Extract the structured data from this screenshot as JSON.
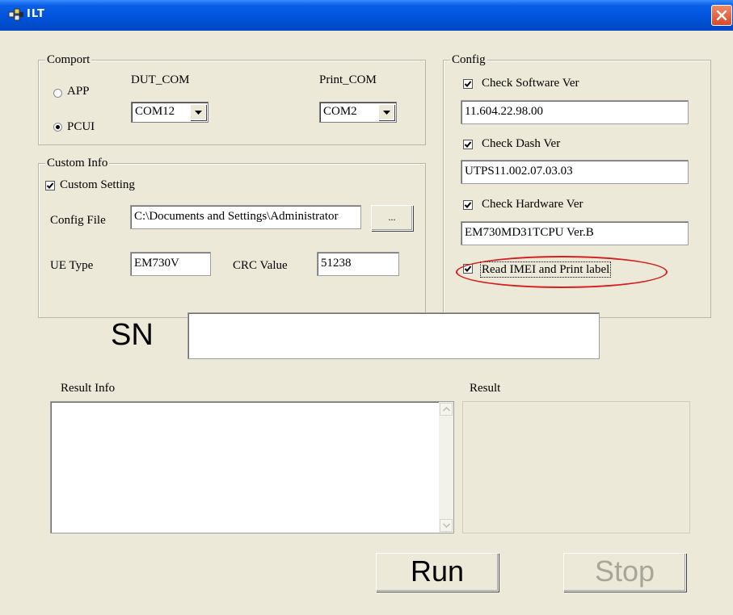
{
  "window": {
    "title": "ILT",
    "close_icon": "close-icon"
  },
  "comport": {
    "label": "Comport",
    "radio_app": "APP",
    "radio_pcui": "PCUI",
    "selected": "PCUI",
    "dut_com_label": "DUT_COM",
    "dut_com_value": "COM12",
    "print_com_label": "Print_COM",
    "print_com_value": "COM2"
  },
  "custom_info": {
    "label": "Custom Info",
    "custom_setting_label": "Custom Setting",
    "custom_setting_checked": true,
    "config_file_label": "Config File",
    "config_file_value": "C:\\Documents and Settings\\Administrator",
    "browse_label": "...",
    "ue_type_label": "UE Type",
    "ue_type_value": "EM730V",
    "crc_label": "CRC Value",
    "crc_value": "51238"
  },
  "config": {
    "label": "Config",
    "check_software_label": "Check Software Ver",
    "software_ver_value": "11.604.22.98.00",
    "check_dash_label": "Check Dash Ver",
    "dash_ver_value": "UTPS11.002.07.03.03",
    "check_hardware_label": "Check  Hardware Ver",
    "hardware_ver_value": "EM730MD31TCPU Ver.B",
    "read_imei_label": "Read  IMEI and Print label",
    "highlight_color": "#d91c1c"
  },
  "sn": {
    "label": "SN",
    "value": ""
  },
  "result_info": {
    "label": "Result Info",
    "text": ""
  },
  "result": {
    "label": "Result"
  },
  "buttons": {
    "run_label": "Run",
    "stop_label": "Stop"
  }
}
